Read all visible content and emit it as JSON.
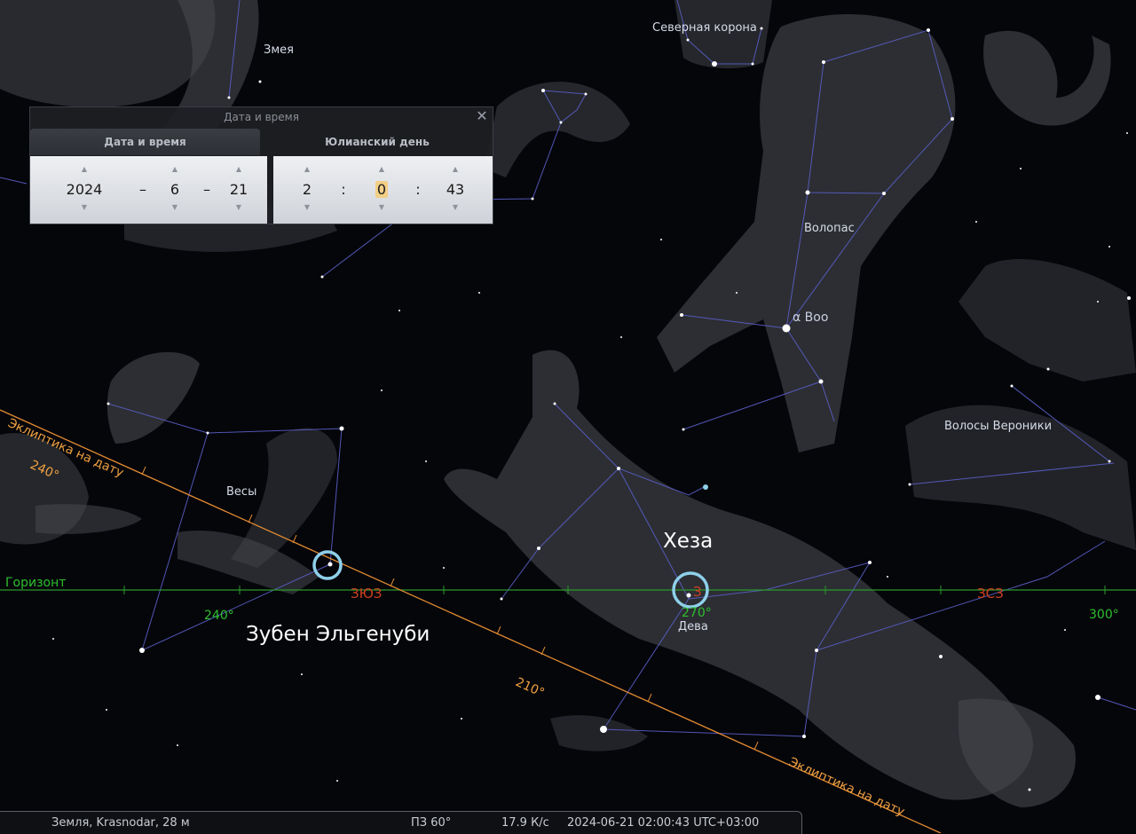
{
  "sky": {
    "constellations": {
      "serpens": "Змея",
      "corona_borealis": "Северная корона",
      "bootes": "Волопас",
      "coma_berenices": "Волосы Вероники",
      "libra": "Весы",
      "virgo": "Дева"
    },
    "stars": {
      "alpha_boo": "α Boo"
    },
    "objects": {
      "heze": "Хеза",
      "zuben": "Зубен Эльгенуби"
    },
    "ecliptic": {
      "label_left": "Эклиптика на дату",
      "label_right": "Эклиптика на дату",
      "deg_240": "240°",
      "deg_210": "210°"
    },
    "horizon": {
      "label": "Горизонт",
      "deg_240": "240°",
      "deg_270": "270°",
      "deg_300": "300°",
      "cardinal_wsw": "ЗЮЗ",
      "cardinal_z": "З",
      "cardinal_wnw": "ЗСЗ"
    }
  },
  "dialog": {
    "title": "Дата и время",
    "tab_datetime": "Дата и время",
    "tab_julian": "Юлианский день",
    "year": "2024",
    "month": "6",
    "day": "21",
    "hour": "2",
    "minute": "0",
    "second": "43",
    "date_sep": "–",
    "time_sep": ":",
    "close_glyph": "✕"
  },
  "status": {
    "location": "Земля, Krasnodar, 28 м",
    "fov": "ПЗ 60°",
    "fps": "17.9 К/с",
    "datetime": "2024-06-21 02:00:43 UTC+03:00"
  },
  "colors": {
    "constellation_lines": "#5a5fc8",
    "ecliptic": "#e08a30",
    "horizon": "#2a9a2a",
    "marker": "#8fd0ea",
    "cardinal": "#d04020"
  },
  "icons": {
    "close": "close-icon",
    "spin_up": "chevron-up-icon",
    "spin_down": "chevron-down-icon"
  }
}
